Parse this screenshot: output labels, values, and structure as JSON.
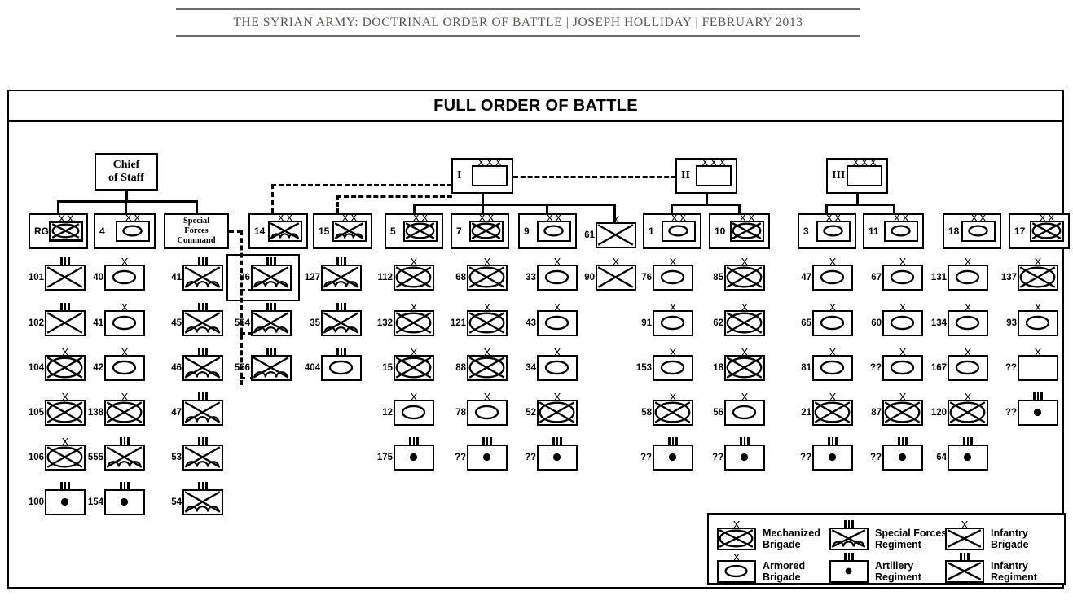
{
  "page_header": "THE SYRIAN ARMY: DOCTRINAL ORDER OF BATTLE | JOSEPH HOLLIDAY | FEBRUARY 2013",
  "diagram": {
    "title": "FULL ORDER OF BATTLE",
    "root": {
      "label_line1": "Chief",
      "label_line2": "of Staff"
    },
    "special_forces_command": {
      "label_line1": "Special",
      "label_line2": "Forces",
      "label_line3": "Command"
    },
    "corps": [
      {
        "label": "I",
        "echelon": "XXX",
        "symbol": "empty"
      },
      {
        "label": "II",
        "echelon": "XXX",
        "symbol": "empty"
      },
      {
        "label": "III",
        "echelon": "XXX",
        "symbol": "empty"
      }
    ],
    "divisions": [
      {
        "label": "RG",
        "echelon": "XX",
        "symbol": "mechanized"
      },
      {
        "label": "4",
        "echelon": "XX",
        "symbol": "armored"
      },
      {
        "label": "14",
        "echelon": "XX",
        "symbol": "special-forces"
      },
      {
        "label": "15",
        "echelon": "XX",
        "symbol": "special-forces"
      },
      {
        "label": "5",
        "echelon": "XX",
        "symbol": "mechanized"
      },
      {
        "label": "7",
        "echelon": "XX",
        "symbol": "mechanized"
      },
      {
        "label": "9",
        "echelon": "XX",
        "symbol": "armored"
      },
      {
        "label": "1",
        "echelon": "XX",
        "symbol": "armored"
      },
      {
        "label": "10",
        "echelon": "XX",
        "symbol": "mechanized"
      },
      {
        "label": "3",
        "echelon": "XX",
        "symbol": "armored"
      },
      {
        "label": "11",
        "echelon": "XX",
        "symbol": "armored"
      },
      {
        "label": "18",
        "echelon": "XX",
        "symbol": "armored"
      },
      {
        "label": "17",
        "echelon": "XX",
        "symbol": "mechanized"
      }
    ],
    "columns": [
      {
        "name": "rg-division-units",
        "units": [
          {
            "label": "101",
            "echelon": "III",
            "symbol": "infantry"
          },
          {
            "label": "102",
            "echelon": "III",
            "symbol": "infantry"
          },
          {
            "label": "104",
            "echelon": "X",
            "symbol": "mechanized"
          },
          {
            "label": "105",
            "echelon": "X",
            "symbol": "mechanized"
          },
          {
            "label": "106",
            "echelon": "X",
            "symbol": "mechanized"
          },
          {
            "label": "100",
            "echelon": "III",
            "symbol": "artillery"
          }
        ]
      },
      {
        "name": "fourth-division-units",
        "units": [
          {
            "label": "40",
            "echelon": "X",
            "symbol": "armored"
          },
          {
            "label": "41",
            "echelon": "X",
            "symbol": "armored"
          },
          {
            "label": "42",
            "echelon": "X",
            "symbol": "armored"
          },
          {
            "label": "138",
            "echelon": "X",
            "symbol": "mechanized"
          },
          {
            "label": "555",
            "echelon": "III",
            "symbol": "special-forces"
          },
          {
            "label": "154",
            "echelon": "III",
            "symbol": "artillery"
          }
        ]
      },
      {
        "name": "special-forces-command-units",
        "units": [
          {
            "label": "41",
            "echelon": "III",
            "symbol": "special-forces"
          },
          {
            "label": "45",
            "echelon": "III",
            "symbol": "special-forces"
          },
          {
            "label": "46",
            "echelon": "III",
            "symbol": "special-forces"
          },
          {
            "label": "47",
            "echelon": "III",
            "symbol": "special-forces"
          },
          {
            "label": "53",
            "echelon": "III",
            "symbol": "special-forces"
          },
          {
            "label": "54",
            "echelon": "III",
            "symbol": "special-forces"
          }
        ]
      },
      {
        "name": "fourteenth-division-units",
        "units": [
          {
            "label": "36",
            "echelon": "III",
            "symbol": "special-forces",
            "boxed": true
          },
          {
            "label": "554",
            "echelon": "III",
            "symbol": "special-forces"
          },
          {
            "label": "556",
            "echelon": "III",
            "symbol": "special-forces"
          }
        ]
      },
      {
        "name": "fifteenth-division-units",
        "units": [
          {
            "label": "127",
            "echelon": "III",
            "symbol": "special-forces"
          },
          {
            "label": "35",
            "echelon": "III",
            "symbol": "special-forces"
          },
          {
            "label": "404",
            "echelon": "III",
            "symbol": "armored"
          }
        ]
      },
      {
        "name": "fifth-division-units",
        "units": [
          {
            "label": "112",
            "echelon": "X",
            "symbol": "mechanized"
          },
          {
            "label": "132",
            "echelon": "X",
            "symbol": "mechanized"
          },
          {
            "label": "15",
            "echelon": "X",
            "symbol": "mechanized"
          },
          {
            "label": "12",
            "echelon": "X",
            "symbol": "armored"
          },
          {
            "label": "175",
            "echelon": "III",
            "symbol": "artillery"
          }
        ]
      },
      {
        "name": "seventh-division-units",
        "units": [
          {
            "label": "68",
            "echelon": "X",
            "symbol": "mechanized"
          },
          {
            "label": "121",
            "echelon": "X",
            "symbol": "mechanized"
          },
          {
            "label": "88",
            "echelon": "X",
            "symbol": "mechanized"
          },
          {
            "label": "78",
            "echelon": "X",
            "symbol": "armored"
          },
          {
            "label": "??",
            "echelon": "III",
            "symbol": "artillery"
          }
        ]
      },
      {
        "name": "ninth-division-units",
        "units": [
          {
            "label": "33",
            "echelon": "X",
            "symbol": "armored"
          },
          {
            "label": "43",
            "echelon": "X",
            "symbol": "armored"
          },
          {
            "label": "34",
            "echelon": "X",
            "symbol": "armored"
          },
          {
            "label": "52",
            "echelon": "X",
            "symbol": "mechanized"
          },
          {
            "label": "??",
            "echelon": "III",
            "symbol": "artillery"
          }
        ]
      },
      {
        "name": "independent-infantry-units",
        "units": [
          {
            "label": "61",
            "echelon": "X",
            "symbol": "infantry"
          },
          {
            "label": "90",
            "echelon": "X",
            "symbol": "infantry"
          }
        ]
      },
      {
        "name": "first-division-units",
        "units": [
          {
            "label": "76",
            "echelon": "X",
            "symbol": "armored"
          },
          {
            "label": "91",
            "echelon": "X",
            "symbol": "armored"
          },
          {
            "label": "153",
            "echelon": "X",
            "symbol": "armored"
          },
          {
            "label": "58",
            "echelon": "X",
            "symbol": "mechanized"
          },
          {
            "label": "??",
            "echelon": "III",
            "symbol": "artillery"
          }
        ]
      },
      {
        "name": "tenth-division-units",
        "units": [
          {
            "label": "85",
            "echelon": "X",
            "symbol": "mechanized"
          },
          {
            "label": "62",
            "echelon": "X",
            "symbol": "mechanized"
          },
          {
            "label": "18",
            "echelon": "X",
            "symbol": "mechanized"
          },
          {
            "label": "56",
            "echelon": "X",
            "symbol": "armored"
          },
          {
            "label": "??",
            "echelon": "III",
            "symbol": "artillery"
          }
        ]
      },
      {
        "name": "third-division-units",
        "units": [
          {
            "label": "47",
            "echelon": "X",
            "symbol": "armored"
          },
          {
            "label": "65",
            "echelon": "X",
            "symbol": "armored"
          },
          {
            "label": "81",
            "echelon": "X",
            "symbol": "armored"
          },
          {
            "label": "21",
            "echelon": "X",
            "symbol": "mechanized"
          },
          {
            "label": "??",
            "echelon": "III",
            "symbol": "artillery"
          }
        ]
      },
      {
        "name": "eleventh-division-units",
        "units": [
          {
            "label": "67",
            "echelon": "X",
            "symbol": "armored"
          },
          {
            "label": "60",
            "echelon": "X",
            "symbol": "armored"
          },
          {
            "label": "??",
            "echelon": "X",
            "symbol": "armored"
          },
          {
            "label": "87",
            "echelon": "X",
            "symbol": "mechanized"
          },
          {
            "label": "??",
            "echelon": "III",
            "symbol": "artillery"
          }
        ]
      },
      {
        "name": "eighteenth-division-units",
        "units": [
          {
            "label": "131",
            "echelon": "X",
            "symbol": "armored"
          },
          {
            "label": "134",
            "echelon": "X",
            "symbol": "armored"
          },
          {
            "label": "167",
            "echelon": "X",
            "symbol": "armored"
          },
          {
            "label": "120",
            "echelon": "X",
            "symbol": "mechanized"
          },
          {
            "label": "64",
            "echelon": "III",
            "symbol": "artillery"
          }
        ]
      },
      {
        "name": "seventeenth-division-units",
        "units": [
          {
            "label": "137",
            "echelon": "X",
            "symbol": "mechanized"
          },
          {
            "label": "93",
            "echelon": "X",
            "symbol": "armored"
          },
          {
            "label": "??",
            "echelon": "X",
            "symbol": "empty"
          },
          {
            "label": "??",
            "echelon": "III",
            "symbol": "artillery"
          }
        ]
      }
    ],
    "legend": {
      "items": [
        {
          "symbol": "mechanized",
          "echelon": "X",
          "line1": "Mechanized",
          "line2": "Brigade"
        },
        {
          "symbol": "special-forces",
          "echelon": "III",
          "line1": "Special Forces",
          "line2": "Regiment"
        },
        {
          "symbol": "infantry",
          "echelon": "X",
          "line1": "Infantry",
          "line2": "Brigade"
        },
        {
          "symbol": "armored",
          "echelon": "X",
          "line1": "Armored",
          "line2": "Brigade"
        },
        {
          "symbol": "artillery",
          "echelon": "III",
          "line1": "Artillery",
          "line2": "Regiment"
        },
        {
          "symbol": "infantry",
          "echelon": "III",
          "line1": "Infantry",
          "line2": "Regiment"
        }
      ]
    }
  }
}
